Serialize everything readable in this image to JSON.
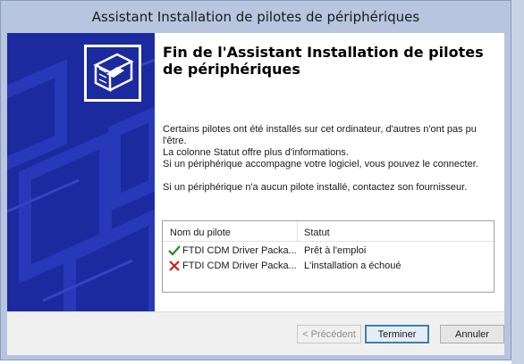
{
  "window": {
    "title": "Assistant Installation de pilotes de périphériques"
  },
  "content": {
    "heading": "Fin de l'Assistant Installation de pilotes de périphériques",
    "para1_line1": "Certains pilotes ont été installés sur cet ordinateur, d'autres n'ont pas pu l'être.",
    "para1_line2": "La colonne Statut offre plus d'informations.",
    "para2": "Si un périphérique accompagne votre logiciel, vous pouvez le connecter.",
    "para3": "Si un périphérique n'a aucun pilote installé, contactez son fournisseur."
  },
  "table": {
    "columns": [
      "Nom du pilote",
      "Statut"
    ],
    "rows": [
      {
        "name": "FTDI CDM Driver Packa...",
        "status": "Prêt à l'emploi",
        "icon": "checkmark-icon"
      },
      {
        "name": "FTDI CDM Driver Packa...",
        "status": "L'installation a échoué",
        "icon": "x-error-icon"
      }
    ]
  },
  "buttons": {
    "back": "< Précédent",
    "finish": "Terminer",
    "cancel": "Annuler"
  },
  "colors": {
    "sidebar": "#1c2aa0",
    "success": "#1f8f1f",
    "error": "#d11c1c"
  }
}
